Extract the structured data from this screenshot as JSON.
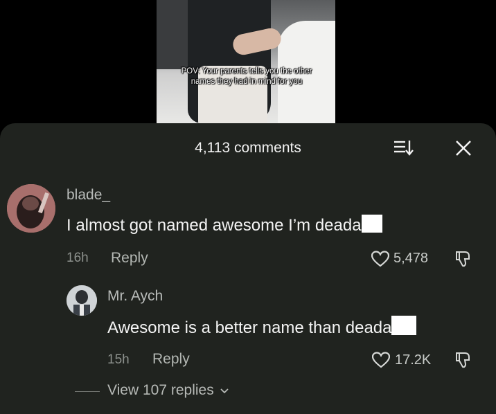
{
  "video": {
    "caption": "POV: Your parents tells you the other names they had in mind for you"
  },
  "header": {
    "comment_count": "4,113 comments"
  },
  "comments": [
    {
      "username": "blade_",
      "text": "I almost got named awesome I’m deada",
      "time": "16h",
      "reply_label": "Reply",
      "likes": "5,478"
    },
    {
      "username": "Mr. Aych",
      "text": "Awesome is a better name than deada",
      "time": "15h",
      "reply_label": "Reply",
      "likes": "17.2K"
    }
  ],
  "thread": {
    "view_replies": "View 107 replies"
  },
  "colors": {
    "panel_bg": "#20231f",
    "text_primary": "#f4f4f4",
    "text_secondary": "#8d918d"
  },
  "icons": [
    "sort-icon",
    "close-icon",
    "heart-icon",
    "dislike-icon",
    "chevron-down-icon"
  ]
}
